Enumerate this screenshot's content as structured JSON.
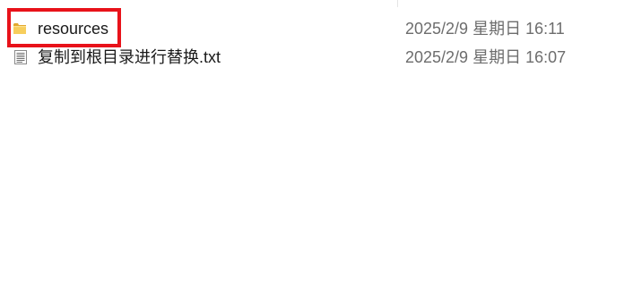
{
  "files": [
    {
      "name": "resources",
      "date_modified": "2025/2/9 星期日 16:11",
      "icon": "folder-icon",
      "highlighted": true
    },
    {
      "name": "复制到根目录进行替换.txt",
      "date_modified": "2025/2/9 星期日 16:07",
      "icon": "text-file-icon",
      "highlighted": false
    }
  ],
  "colors": {
    "highlight": "#e8121a",
    "folder": "#f3c34b",
    "date_text": "#6d6d6d",
    "name_text": "#1a1a1a"
  }
}
